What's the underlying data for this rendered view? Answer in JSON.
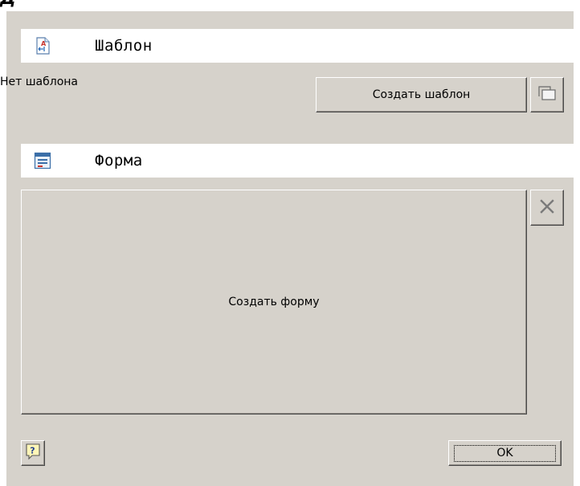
{
  "window": {
    "title_fragment": "Д"
  },
  "template_section": {
    "header_title": "Шаблон",
    "header_icon": "template-document-icon",
    "status_text": "Нет шаблона",
    "create_button_label": "Создать шаблон",
    "copy_button_icon": "copy-icon"
  },
  "form_section": {
    "header_title": "Форма",
    "header_icon": "form-window-icon",
    "create_form_label": "Создать форму",
    "delete_button_icon": "close-icon"
  },
  "footer": {
    "help_icon": "help-icon",
    "ok_label": "OK"
  },
  "colors": {
    "dialog_background": "#d6d2cb",
    "header_background": "#ffffff",
    "icon_red": "#c8342c",
    "icon_blue": "#2f6fba"
  }
}
